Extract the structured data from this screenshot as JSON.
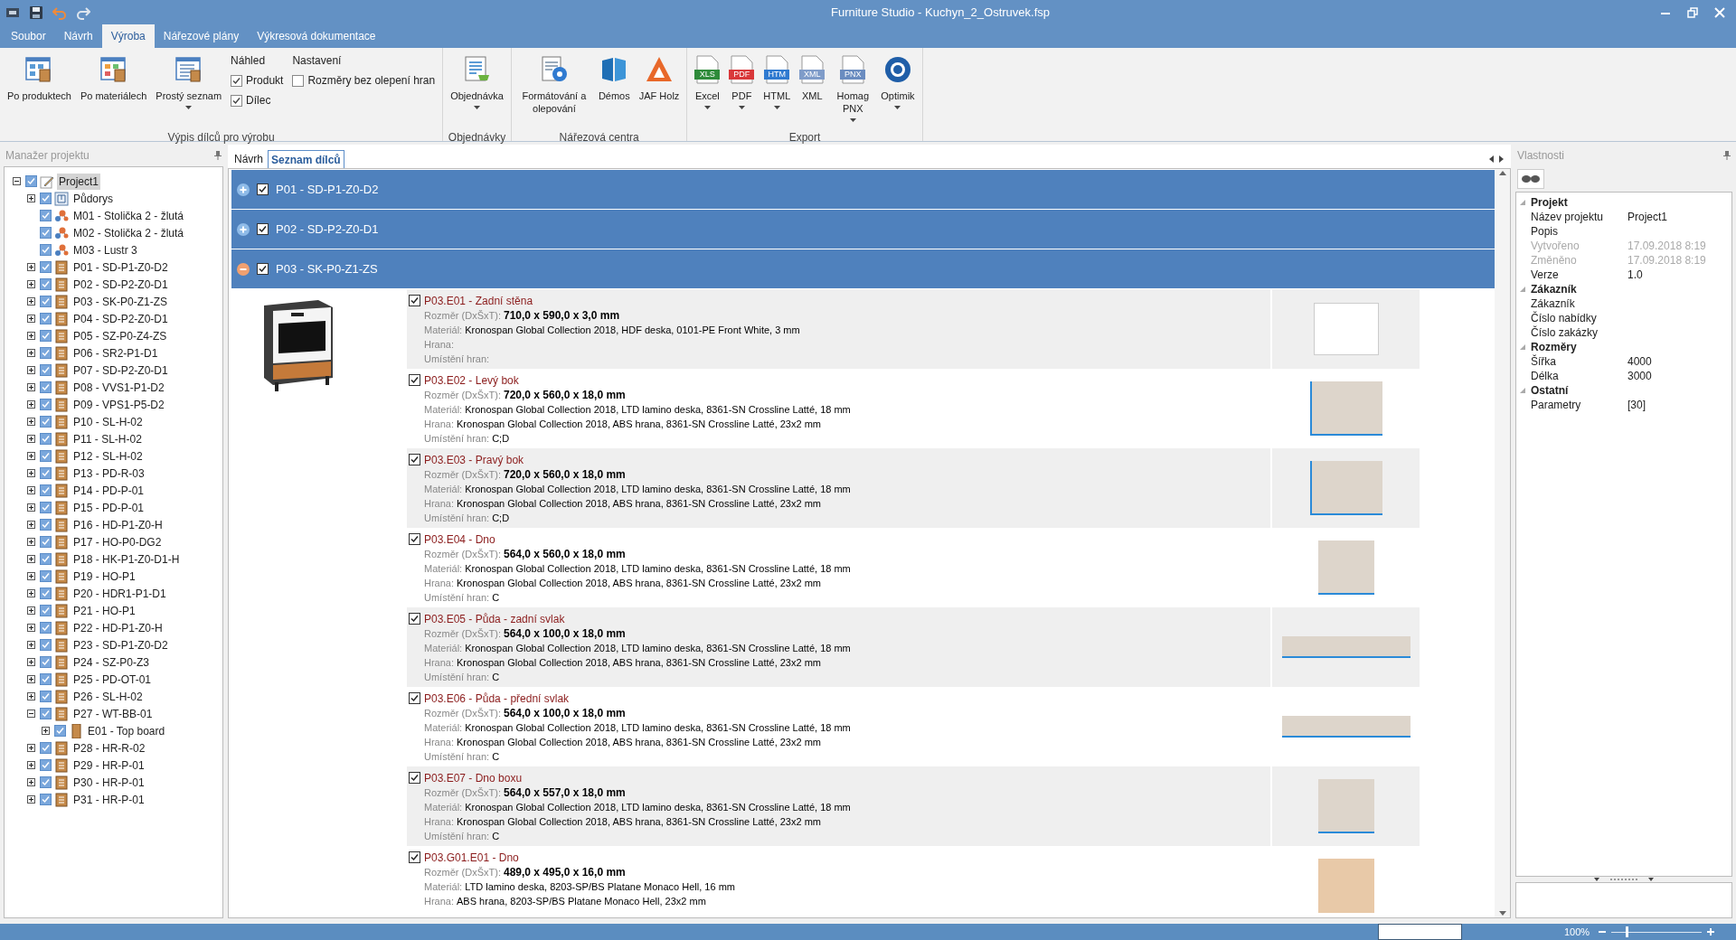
{
  "window": {
    "title": "Furniture Studio - Kuchyn_2_Ostruvek.fsp"
  },
  "menu_tabs": [
    {
      "label": "Soubor",
      "selected": false
    },
    {
      "label": "Návrh",
      "selected": false
    },
    {
      "label": "Výroba",
      "selected": true
    },
    {
      "label": "Nářezové plány",
      "selected": false
    },
    {
      "label": "Výkresová dokumentace",
      "selected": false
    }
  ],
  "ribbon_groups": [
    {
      "label": "Výpis dílců pro výrobu",
      "items": [
        {
          "kind": "button",
          "label": "Po produktech",
          "dropdown": false
        },
        {
          "kind": "button",
          "label": "Po materiálech",
          "dropdown": false
        },
        {
          "kind": "button",
          "label": "Prostý seznam",
          "dropdown": true
        },
        {
          "kind": "checks",
          "title": "Náhled",
          "checks": [
            {
              "label": "Produkt",
              "checked": true
            },
            {
              "label": "Dílec",
              "checked": true
            }
          ]
        },
        {
          "kind": "checks",
          "title": "Nastavení",
          "checks": [
            {
              "label": "Rozměry bez olepení hran",
              "checked": false
            }
          ]
        }
      ]
    },
    {
      "label": "Objednávky",
      "items": [
        {
          "kind": "button",
          "label": "Objednávka",
          "dropdown": true
        }
      ]
    },
    {
      "label": "Nářezová centra",
      "items": [
        {
          "kind": "button",
          "label": "Formátování a olepování",
          "dropdown": false
        },
        {
          "kind": "button",
          "label": "Démos",
          "dropdown": false
        },
        {
          "kind": "button",
          "label": "JAF Holz",
          "dropdown": false
        }
      ]
    },
    {
      "label": "Export",
      "items": [
        {
          "kind": "file",
          "badge": "XLS",
          "label": "Excel",
          "dropdown": true
        },
        {
          "kind": "file",
          "badge": "PDF",
          "label": "PDF",
          "dropdown": true
        },
        {
          "kind": "file",
          "badge": "HTM",
          "label": "HTML",
          "dropdown": true
        },
        {
          "kind": "file",
          "badge": "XML",
          "label": "XML",
          "dropdown": false
        },
        {
          "kind": "file",
          "badge": "PNX",
          "label": "Homag PNX",
          "dropdown": true
        },
        {
          "kind": "button",
          "label": "Optimik",
          "dropdown": true
        }
      ]
    }
  ],
  "project_tree": {
    "title": "Manažer projektu",
    "items": [
      {
        "kind": "project",
        "label": "Project1",
        "checked": true,
        "selected": true,
        "expanded": true,
        "children": [
          {
            "kind": "floorplan",
            "label": "Půdorys",
            "checked": true,
            "selected": false,
            "expanded": false
          },
          {
            "kind": "model",
            "label": "M01 - Stolička 2 - žlutá",
            "checked": true,
            "selected": false
          },
          {
            "kind": "model",
            "label": "M02 - Stolička 2 - žlutá",
            "checked": true,
            "selected": false
          },
          {
            "kind": "model",
            "label": "M03 - Lustr 3",
            "checked": true,
            "selected": false
          },
          {
            "kind": "product",
            "label": "P01 - SD-P1-Z0-D2",
            "checked": true,
            "selected": false,
            "expanded": false
          },
          {
            "kind": "product",
            "label": "P02 - SD-P2-Z0-D1",
            "checked": true,
            "selected": false,
            "expanded": false
          },
          {
            "kind": "product",
            "label": "P03 - SK-P0-Z1-ZS",
            "checked": true,
            "selected": false,
            "expanded": false
          },
          {
            "kind": "product",
            "label": "P04 - SD-P2-Z0-D1",
            "checked": true,
            "selected": false,
            "expanded": false
          },
          {
            "kind": "product",
            "label": "P05 - SZ-P0-Z4-ZS",
            "checked": true,
            "selected": false,
            "expanded": false
          },
          {
            "kind": "product",
            "label": "P06 - SR2-P1-D1",
            "checked": true,
            "selected": false,
            "expanded": false
          },
          {
            "kind": "product",
            "label": "P07 - SD-P2-Z0-D1",
            "checked": true,
            "selected": false,
            "expanded": false
          },
          {
            "kind": "product",
            "label": "P08 - VVS1-P1-D2",
            "checked": true,
            "selected": false,
            "expanded": false
          },
          {
            "kind": "product",
            "label": "P09 - VPS1-P5-D2",
            "checked": true,
            "selected": false,
            "expanded": false
          },
          {
            "kind": "product",
            "label": "P10 - SL-H-02",
            "checked": true,
            "selected": false,
            "expanded": false
          },
          {
            "kind": "product",
            "label": "P11 - SL-H-02",
            "checked": true,
            "selected": false,
            "expanded": false
          },
          {
            "kind": "product",
            "label": "P12 - SL-H-02",
            "checked": true,
            "selected": false,
            "expanded": false
          },
          {
            "kind": "product",
            "label": "P13 - PD-R-03",
            "checked": true,
            "selected": false,
            "expanded": false
          },
          {
            "kind": "product",
            "label": "P14 - PD-P-01",
            "checked": true,
            "selected": false,
            "expanded": false
          },
          {
            "kind": "product",
            "label": "P15 - PD-P-01",
            "checked": true,
            "selected": false,
            "expanded": false
          },
          {
            "kind": "product",
            "label": "P16 - HD-P1-Z0-H",
            "checked": true,
            "selected": false,
            "expanded": false
          },
          {
            "kind": "product",
            "label": "P17 - HO-P0-DG2",
            "checked": true,
            "selected": false,
            "expanded": false
          },
          {
            "kind": "product",
            "label": "P18 - HK-P1-Z0-D1-H",
            "checked": true,
            "selected": false,
            "expanded": false
          },
          {
            "kind": "product",
            "label": "P19 - HO-P1",
            "checked": true,
            "selected": false,
            "expanded": false
          },
          {
            "kind": "product",
            "label": "P20 - HDR1-P1-D1",
            "checked": true,
            "selected": false,
            "expanded": false
          },
          {
            "kind": "product",
            "label": "P21 - HO-P1",
            "checked": true,
            "selected": false,
            "expanded": false
          },
          {
            "kind": "product",
            "label": "P22 - HD-P1-Z0-H",
            "checked": true,
            "selected": false,
            "expanded": false
          },
          {
            "kind": "product",
            "label": "P23 - SD-P1-Z0-D2",
            "checked": true,
            "selected": false,
            "expanded": false
          },
          {
            "kind": "product",
            "label": "P24 - SZ-P0-Z3",
            "checked": true,
            "selected": false,
            "expanded": false
          },
          {
            "kind": "product",
            "label": "P25 - PD-OT-01",
            "checked": true,
            "selected": false,
            "expanded": false
          },
          {
            "kind": "product",
            "label": "P26 - SL-H-02",
            "checked": true,
            "selected": false,
            "expanded": false
          },
          {
            "kind": "product",
            "label": "P27 - WT-BB-01",
            "checked": true,
            "selected": false,
            "expanded": true,
            "children": [
              {
                "kind": "element",
                "label": "E01 - Top board",
                "checked": true,
                "selected": false,
                "expanded": false
              }
            ]
          },
          {
            "kind": "product",
            "label": "P28 - HR-R-02",
            "checked": true,
            "selected": false,
            "expanded": false
          },
          {
            "kind": "product",
            "label": "P29 - HR-P-01",
            "checked": true,
            "selected": false,
            "expanded": false
          },
          {
            "kind": "product",
            "label": "P30 - HR-P-01",
            "checked": true,
            "selected": false,
            "expanded": false
          },
          {
            "kind": "product",
            "label": "P31 - HR-P-01",
            "checked": true,
            "selected": false,
            "expanded": false
          }
        ]
      }
    ]
  },
  "document_tabs": [
    {
      "label": "Návrh",
      "selected": false
    },
    {
      "label": "Seznam dílců",
      "selected": true
    }
  ],
  "product_groups": [
    {
      "label": "P01 - SD-P1-Z0-D2",
      "checked": true,
      "expanded": false
    },
    {
      "label": "P02 - SD-P2-Z0-D1",
      "checked": true,
      "expanded": false
    },
    {
      "label": "P03 - SK-P0-Z1-ZS",
      "checked": true,
      "expanded": true,
      "parts": [
        {
          "title": "P03.E01 - Zadní stěna",
          "checked": true,
          "thumb": {
            "kind": "sheet",
            "color": "#ffffff"
          },
          "lines": [
            {
              "label": "Rozměr (DxŠxT):",
              "value": "710,0 x 590,0 x 3,0 mm",
              "kind": "size"
            },
            {
              "label": "Materiál:",
              "value": "Kronospan Global Collection 2018, HDF deska, 0101-PE Front White, 3 mm",
              "kind": "text"
            },
            {
              "label": "Hrana:",
              "kind": "text"
            },
            {
              "label": "Umístění hran:",
              "kind": "text"
            }
          ]
        },
        {
          "title": "P03.E02 - Levý bok",
          "checked": true,
          "thumb": {
            "kind": "slab",
            "color": "#ddd5cb"
          },
          "lines": [
            {
              "label": "Rozměr (DxŠxT):",
              "value": "720,0 x 560,0 x 18,0 mm",
              "kind": "size"
            },
            {
              "label": "Materiál:",
              "value": "Kronospan Global Collection 2018, LTD lamino deska, 8361-SN Crossline Latté, 18 mm",
              "kind": "text"
            },
            {
              "label": "Hrana:",
              "value": "Kronospan Global Collection 2018, ABS hrana, 8361-SN Crossline Latté, 23x2 mm",
              "kind": "text"
            },
            {
              "label": "Umístění hran:",
              "value": "C;D",
              "kind": "text"
            }
          ]
        },
        {
          "title": "P03.E03 - Pravý bok",
          "checked": true,
          "thumb": {
            "kind": "slab",
            "color": "#ddd5cb"
          },
          "lines": [
            {
              "label": "Rozměr (DxŠxT):",
              "value": "720,0 x 560,0 x 18,0 mm",
              "kind": "size"
            },
            {
              "label": "Materiál:",
              "value": "Kronospan Global Collection 2018, LTD lamino deska, 8361-SN Crossline Latté, 18 mm",
              "kind": "text"
            },
            {
              "label": "Hrana:",
              "value": "Kronospan Global Collection 2018, ABS hrana, 8361-SN Crossline Latté, 23x2 mm",
              "kind": "text"
            },
            {
              "label": "Umístění hran:",
              "value": "C;D",
              "kind": "text"
            }
          ]
        },
        {
          "title": "P03.E04 - Dno",
          "checked": true,
          "thumb": {
            "kind": "block",
            "color": "#ddd5cb"
          },
          "lines": [
            {
              "label": "Rozměr (DxŠxT):",
              "value": "564,0 x 560,0 x 18,0 mm",
              "kind": "size"
            },
            {
              "label": "Materiál:",
              "value": "Kronospan Global Collection 2018, LTD lamino deska, 8361-SN Crossline Latté, 18 mm",
              "kind": "text"
            },
            {
              "label": "Hrana:",
              "value": "Kronospan Global Collection 2018, ABS hrana, 8361-SN Crossline Latté, 23x2 mm",
              "kind": "text"
            },
            {
              "label": "Umístění hran:",
              "value": "C",
              "kind": "text"
            }
          ]
        },
        {
          "title": "P03.E05 - Půda - zadní svlak",
          "checked": true,
          "thumb": {
            "kind": "strip",
            "color": "#ddd5cb"
          },
          "lines": [
            {
              "label": "Rozměr (DxŠxT):",
              "value": "564,0 x 100,0 x 18,0 mm",
              "kind": "size"
            },
            {
              "label": "Materiál:",
              "value": "Kronospan Global Collection 2018, LTD lamino deska, 8361-SN Crossline Latté, 18 mm",
              "kind": "text"
            },
            {
              "label": "Hrana:",
              "value": "Kronospan Global Collection 2018, ABS hrana, 8361-SN Crossline Latté, 23x2 mm",
              "kind": "text"
            },
            {
              "label": "Umístění hran:",
              "value": "C",
              "kind": "text"
            }
          ]
        },
        {
          "title": "P03.E06 - Půda - přední svlak",
          "checked": true,
          "thumb": {
            "kind": "strip",
            "color": "#ddd5cb"
          },
          "lines": [
            {
              "label": "Rozměr (DxŠxT):",
              "value": "564,0 x 100,0 x 18,0 mm",
              "kind": "size"
            },
            {
              "label": "Materiál:",
              "value": "Kronospan Global Collection 2018, LTD lamino deska, 8361-SN Crossline Latté, 18 mm",
              "kind": "text"
            },
            {
              "label": "Hrana:",
              "value": "Kronospan Global Collection 2018, ABS hrana, 8361-SN Crossline Latté, 23x2 mm",
              "kind": "text"
            },
            {
              "label": "Umístění hran:",
              "value": "C",
              "kind": "text"
            }
          ]
        },
        {
          "title": "P03.E07 - Dno boxu",
          "checked": true,
          "thumb": {
            "kind": "block",
            "color": "#ddd5cb"
          },
          "lines": [
            {
              "label": "Rozměr (DxŠxT):",
              "value": "564,0 x 557,0 x 18,0 mm",
              "kind": "size"
            },
            {
              "label": "Materiál:",
              "value": "Kronospan Global Collection 2018, LTD lamino deska, 8361-SN Crossline Latté, 18 mm",
              "kind": "text"
            },
            {
              "label": "Hrana:",
              "value": "Kronospan Global Collection 2018, ABS hrana, 8361-SN Crossline Latté, 23x2 mm",
              "kind": "text"
            },
            {
              "label": "Umístění hran:",
              "value": "C",
              "kind": "text"
            }
          ]
        },
        {
          "title": "P03.G01.E01 - Dno",
          "checked": true,
          "thumb": {
            "kind": "tile",
            "color": "#e8c9a8"
          },
          "lines": [
            {
              "label": "Rozměr (DxŠxT):",
              "value": "489,0 x 495,0 x 16,0 mm",
              "kind": "size"
            },
            {
              "label": "Materiál:",
              "value": "LTD lamino deska, 8203-SP/BS Platane Monaco Hell, 16 mm",
              "kind": "text"
            },
            {
              "label": "Hrana:",
              "value": "ABS hrana, 8203-SP/BS Platane Monaco Hell, 23x2 mm",
              "kind": "text"
            }
          ]
        }
      ]
    }
  ],
  "properties": {
    "title": "Vlastnosti",
    "categories": [
      {
        "label": "Projekt",
        "expanded": true,
        "rows": [
          {
            "name": "Název projektu",
            "value": "Project1",
            "disabled": false
          },
          {
            "name": "Popis",
            "disabled": false
          },
          {
            "name": "Vytvořeno",
            "value": "17.09.2018 8:19",
            "disabled": true
          },
          {
            "name": "Změněno",
            "value": "17.09.2018 8:19",
            "disabled": true
          },
          {
            "name": "Verze",
            "value": "1.0",
            "disabled": false
          }
        ]
      },
      {
        "label": "Zákazník",
        "expanded": true,
        "rows": [
          {
            "name": "Zákazník",
            "disabled": false
          },
          {
            "name": "Číslo nabídky",
            "disabled": false
          },
          {
            "name": "Číslo zakázky",
            "disabled": false
          }
        ]
      },
      {
        "label": "Rozměry",
        "expanded": true,
        "rows": [
          {
            "name": "Šířka",
            "value": "4000",
            "disabled": false
          },
          {
            "name": "Délka",
            "value": "3000",
            "disabled": false
          }
        ]
      },
      {
        "label": "Ostatní",
        "expanded": true,
        "rows": [
          {
            "name": "Parametry",
            "value": "[30]",
            "disabled": false
          }
        ]
      }
    ]
  },
  "status_bar": {
    "zoom": {
      "reading": "100%",
      "level": 0.16
    }
  }
}
